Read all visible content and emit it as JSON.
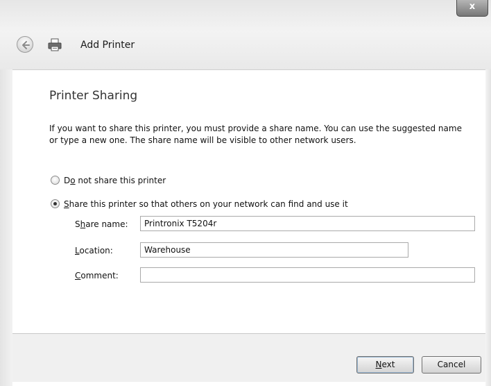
{
  "window": {
    "title": "Add Printer",
    "close_label": "x"
  },
  "content": {
    "heading": "Printer Sharing",
    "description": "If you want to share this printer, you must provide a share name. You can use the suggested name or type a new one. The share name will be visible to other network users."
  },
  "options": {
    "no_share": {
      "mnemonic_pre": "D",
      "mnemonic": "o",
      "rest": " not share this printer",
      "selected": false
    },
    "share": {
      "mnemonic": "S",
      "rest": "hare this printer so that others on your network can find and use it",
      "selected": true
    }
  },
  "fields": {
    "share_name": {
      "pre": "S",
      "mnemonic": "h",
      "rest": "are name:",
      "value": "Printronix T5204r"
    },
    "location": {
      "mnemonic": "L",
      "rest": "ocation:",
      "value": "Warehouse"
    },
    "comment": {
      "mnemonic": "C",
      "rest": "omment:",
      "value": ""
    }
  },
  "buttons": {
    "next_mnemonic": "N",
    "next_rest": "ext",
    "cancel": "Cancel"
  },
  "icons": {
    "back": "back-arrow-icon",
    "printer": "printer-icon"
  }
}
